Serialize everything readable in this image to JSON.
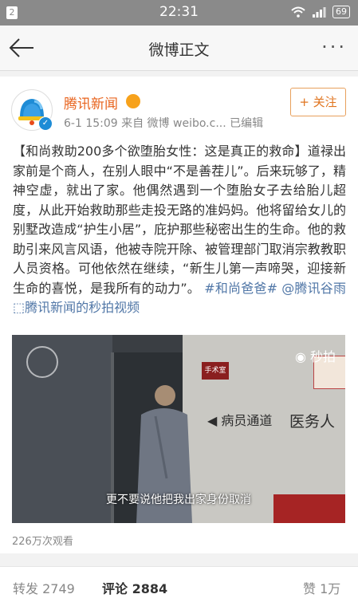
{
  "status_bar": {
    "notification_count": "2",
    "time": "22:31",
    "battery": "69"
  },
  "nav": {
    "title": "微博正文"
  },
  "post": {
    "author": "腾讯新闻",
    "meta": "6-1 15:09  来自 微博 weibo.c...  已编辑",
    "follow_label": "+ 关注",
    "text_main": "【和尚救助200多个欲堕胎女性：这是真正的救命】道禄出家前是个商人，在别人眼中“不是善茬儿”。后来玩够了，精神空虚，就出了家。他偶然遇到一个堕胎女子去给胎儿超度，从此开始救助那些走投无路的准妈妈。他将留给女儿的别墅改造成“护生小居”，庇护那些秘密出生的生命。他的救助引来风言风语，他被寺院开除、被管理部门取消宗教教职人员资格。可他依然在继续，“新生儿第一声啼哭，迎接新生命的喜悦，是我所有的动力”。",
    "hashtag": "#和尚爸爸#",
    "mention": "@腾讯谷雨",
    "video_link": "腾讯新闻的秒拍视频",
    "video": {
      "watermark": "秒拍",
      "subtitle": "更不要说他把我出家身份取消",
      "sign_small": "手术室",
      "wall_text_1": "病员通道",
      "wall_text_2": "医务人"
    },
    "views": "226万次观看"
  },
  "tabs": {
    "repost": "转发 2749",
    "comment": "评论 2884",
    "like": "赞 1万"
  }
}
